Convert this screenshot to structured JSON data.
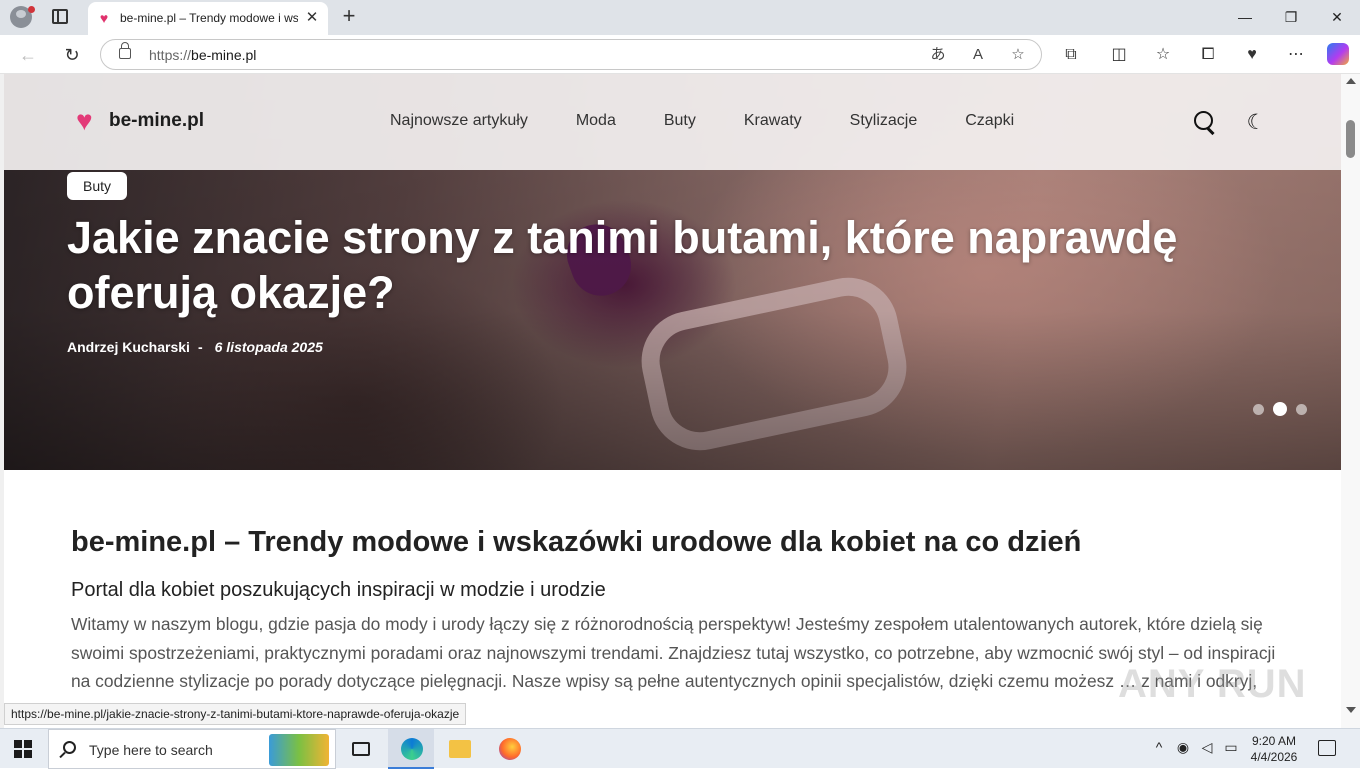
{
  "browser": {
    "tab": {
      "title": "be-mine.pl – Trendy modowe i wskazówki urodowe",
      "close": "✕"
    },
    "new_tab": "+",
    "window_controls": {
      "minimize": "—",
      "restore": "❐",
      "close": "✕"
    },
    "nav": {
      "back": "←",
      "reload": "↻"
    },
    "url": {
      "scheme": "https://",
      "host": "be-mine.pl"
    },
    "omnibox_icons": {
      "translate": "あ",
      "read_aloud": "A",
      "favorite": "☆"
    },
    "toolbar_icons": {
      "extensions": "⧉",
      "split": "◫",
      "favorites": "☆",
      "collections": "⧠",
      "performance": "♥",
      "more": "⋯"
    },
    "icons": [
      "profile-icon",
      "tab-actions-icon",
      "lock-icon",
      "copilot-icon"
    ]
  },
  "site": {
    "logo_text": "be-mine.pl",
    "logo_icon": "♥",
    "menu": [
      {
        "label": "Najnowsze artykuły"
      },
      {
        "label": "Moda"
      },
      {
        "label": "Buty"
      },
      {
        "label": "Krawaty"
      },
      {
        "label": "Stylizacje"
      },
      {
        "label": "Czapki"
      }
    ],
    "dark_mode_icon": "☾"
  },
  "hero": {
    "category": "Buty",
    "title": "Jakie znacie strony z tanimi butami, które naprawdę oferują okazje?",
    "author": "Andrzej Kucharski",
    "separator": "-",
    "date": "6 listopada 2025",
    "slides_total": 3,
    "active_slide": 2
  },
  "content": {
    "heading": "be-mine.pl – Trendy modowe i wskazówki urodowe dla kobiet na co dzień",
    "subheading": "Portal dla kobiet poszukujących inspiracji w modzie i urodzie",
    "paragraph": "Witamy w naszym blogu, gdzie pasja do mody i urody łączy się z różnorodnością perspektyw! Jesteśmy zespołem utalentowanych autorek, które dzielą się swoimi spostrzeżeniami, praktycznymi poradami oraz najnowszymi trendami. Znajdziesz tutaj wszystko, co potrzebne, aby wzmocnić swój styl – od inspiracji na codzienne stylizacje po porady dotyczące pielęgnacji. Nasze wpisy są pełne autentycznych opinii specjalistów, dzięki czemu możesz … z nami i odkryj, jak moda i uroda mogą wzbogacić Twoje życie!"
  },
  "status_link": "https://be-mine.pl/jakie-znacie-strony-z-tanimi-butami-ktore-naprawde-oferuja-okazje",
  "watermark": "ANY RUN",
  "taskbar": {
    "search_placeholder": "Type here to search",
    "tray": {
      "chevron": "^",
      "meet": "◉",
      "volume": "◁",
      "network": "▭"
    },
    "time": "9:20 AM",
    "date": "4/4/2026"
  },
  "colors": {
    "brand_pink": "#e33a78",
    "taskbar_bg": "#e8edf3"
  }
}
